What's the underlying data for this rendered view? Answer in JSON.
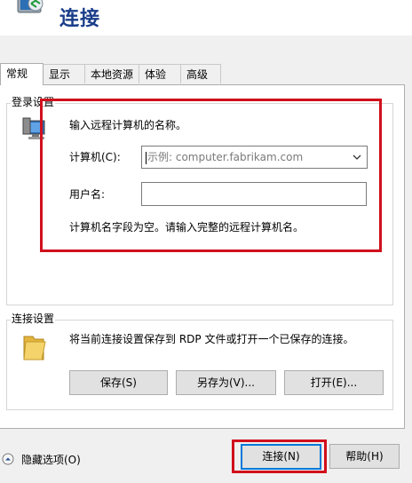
{
  "header": {
    "title": "连接",
    "icon": "remote-desktop-icon"
  },
  "tabs": [
    "常规",
    "显示",
    "本地资源",
    "体验",
    "高级"
  ],
  "logon": {
    "legend": "登录设置",
    "icon": "computer-icon",
    "instruction": "输入远程计算机的名称。",
    "computer_label": "计算机(C):",
    "computer_placeholder": "示例: computer.fabrikam.com",
    "username_label": "用户名:",
    "username_value": "",
    "warning": "计算机名字段为空。请输入完整的远程计算机名。"
  },
  "connection": {
    "legend": "连接设置",
    "icon": "folder-icon",
    "description": "将当前连接设置保存到 RDP 文件或打开一个已保存的连接。",
    "save_label": "保存(S)",
    "save_as_label": "另存为(V)...",
    "open_label": "打开(E)..."
  },
  "footer": {
    "hide_options_label": "隐藏选项(O)",
    "connect_label": "连接(N)",
    "help_label": "帮助(H)"
  },
  "colors": {
    "title": "#1a3d8a",
    "highlight": "#d0101c",
    "default_button_border": "#0078d7"
  }
}
